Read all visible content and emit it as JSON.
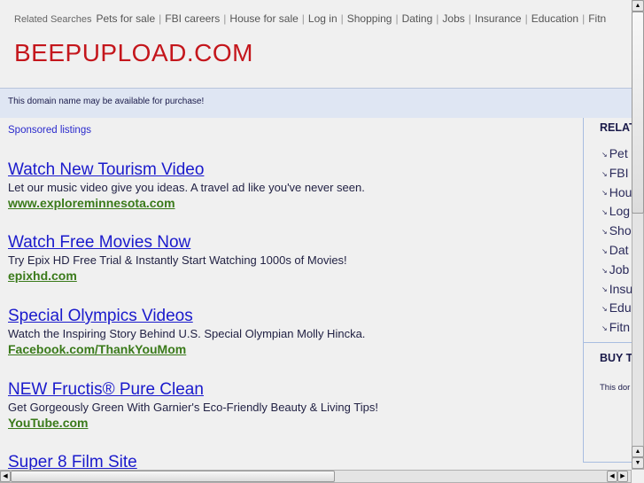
{
  "top_bar": {
    "label": "Related Searches",
    "links": [
      "Pets for sale",
      "FBI careers",
      "House for sale",
      "Log in",
      "Shopping",
      "Dating",
      "Jobs",
      "Insurance",
      "Education",
      "Fitn"
    ]
  },
  "logo": "BEEPUPLOAD.COM",
  "banner": "This domain name may be available for purchase!",
  "sponsored": "Sponsored listings",
  "ads": [
    {
      "title": "Watch New Tourism Video",
      "desc": "Let our music video give you ideas. A travel ad like you've never seen.",
      "url": "www.exploreminnesota.com"
    },
    {
      "title": "Watch Free Movies Now",
      "desc": "Try Epix HD Free Trial & Instantly Start Watching 1000s of Movies!",
      "url": "epixhd.com"
    },
    {
      "title": "Special Olympics Videos",
      "desc": "Watch the Inspiring Story Behind U.S. Special Olympian Molly Hincka.",
      "url": "Facebook.com/ThankYouMom"
    },
    {
      "title": "NEW Fructis® Pure Clean",
      "desc": "Get Gorgeously Green With Garnier's Eco-Friendly Beauty & Living Tips!",
      "url": "YouTube.com"
    },
    {
      "title": "Super 8 Film Site",
      "desc": "",
      "url": ""
    }
  ],
  "sidebar": {
    "heading": "RELAT",
    "items": [
      "Pet",
      "FBI",
      "Hou",
      "Log",
      "Sho",
      "Dat",
      "Job",
      "Insu",
      "Edu",
      "Fitn"
    ],
    "buy_heading": "BUY T",
    "buy_text": "This dor"
  }
}
